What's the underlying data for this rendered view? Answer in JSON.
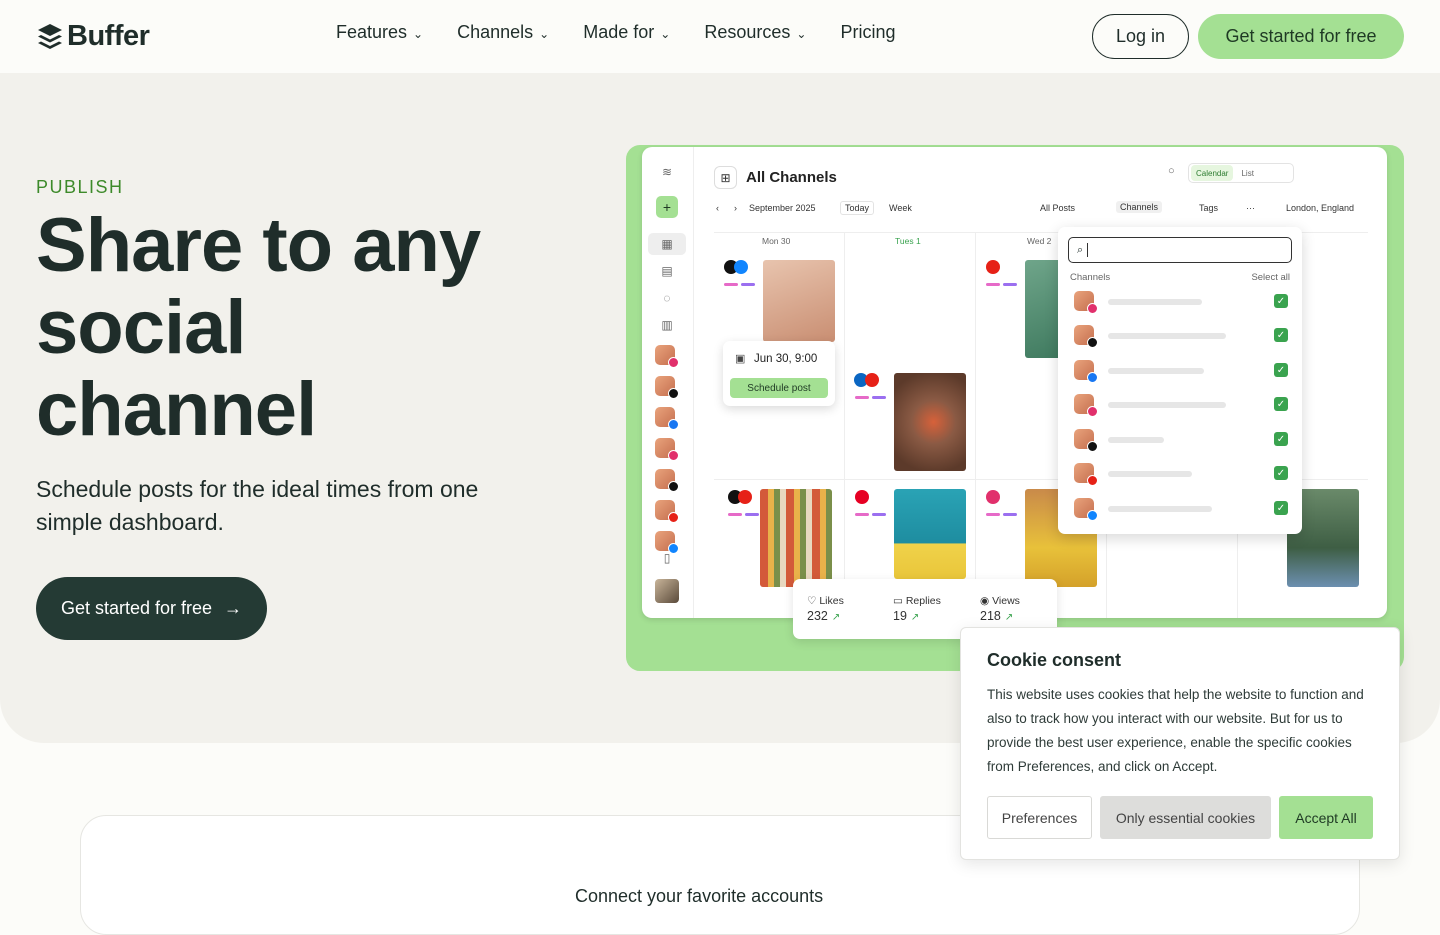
{
  "nav": {
    "logo_text": "Buffer",
    "links": [
      "Features",
      "Channels",
      "Made for",
      "Resources",
      "Pricing"
    ],
    "login_label": "Log in",
    "cta_label": "Get started for free"
  },
  "hero": {
    "eyebrow": "PUBLISH",
    "headline_line1": "Share to any",
    "headline_line2": "social",
    "headline_line3": "channel",
    "subhead": "Schedule posts for the ideal times from one simple dashboard.",
    "cta_label": "Get started for free"
  },
  "app": {
    "title": "All Channels",
    "view_calendar": "Calendar",
    "view_list": "List",
    "month": "September 2025",
    "today": "Today",
    "range": "Week",
    "all_posts": "All Posts",
    "channels": "Channels",
    "tags": "Tags",
    "more": "···",
    "timezone": "London, England",
    "days": [
      "Mon 30",
      "Tues 1",
      "Wed 2"
    ],
    "schedule_popup": {
      "date": "Jun 30, 9:00",
      "button": "Schedule post"
    },
    "channel_popup": {
      "label": "Channels",
      "select_all": "Select all"
    },
    "stats": [
      {
        "label": "Likes",
        "value": "232"
      },
      {
        "label": "Replies",
        "value": "19"
      },
      {
        "label": "Views",
        "value": "218"
      }
    ]
  },
  "lower": {
    "heading": "Connect your favorite accounts"
  },
  "cookie": {
    "title": "Cookie consent",
    "body": "This website uses cookies that help the website to function and also to track how you interact with our website. But for us to provide the best user experience, enable the specific cookies from Preferences, and click on Accept.",
    "preferences": "Preferences",
    "essential": "Only essential cookies",
    "accept": "Accept All"
  },
  "colors": {
    "accent_green": "#a4e093",
    "dark_teal": "#243a34",
    "eyebrow_green": "#3d8a2a",
    "hero_bg": "#f2f1ec"
  }
}
